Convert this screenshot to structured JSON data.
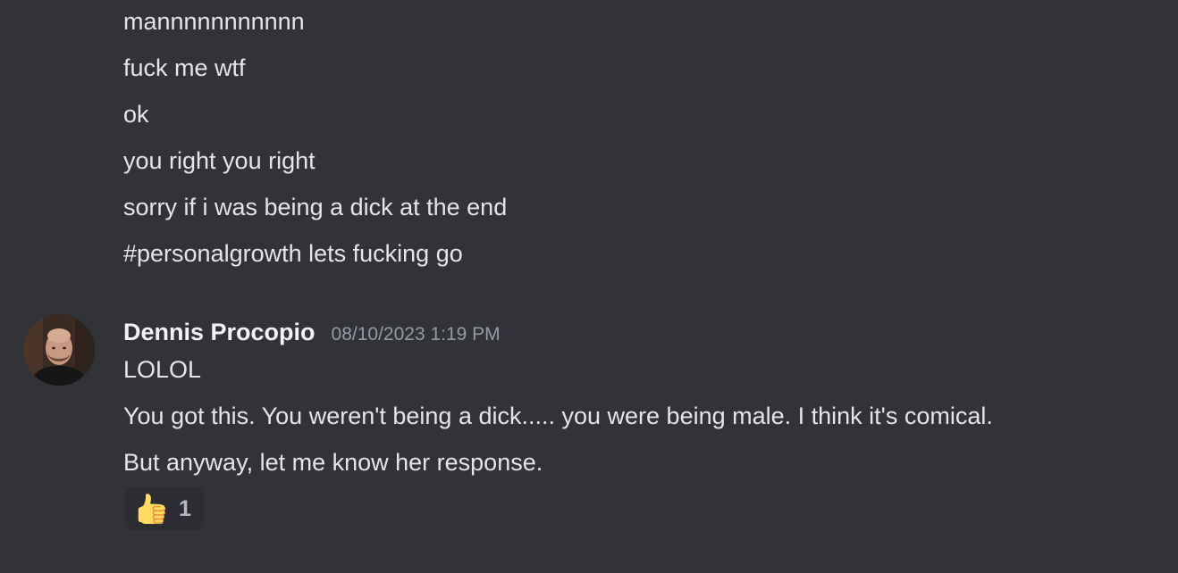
{
  "previous_messages": [
    "mannnnnnnnnnn",
    "fuck me wtf",
    "ok",
    "you right you right",
    "sorry if i was being a dick at the end",
    "#personalgrowth lets fucking go"
  ],
  "message": {
    "author": "Dennis Procopio",
    "timestamp": "08/10/2023 1:19 PM",
    "lines": [
      "LOLOL",
      "You got this. You weren't being a dick..... you were being male. I think it's comical.",
      "But anyway, let me know her response."
    ],
    "avatar_icon": "user-avatar-photo",
    "reaction": {
      "emoji_icon": "thumbs-up-icon",
      "count": "1"
    }
  },
  "colors": {
    "background": "#313338",
    "text": "#e3e5e8",
    "username": "#f2f3f5",
    "timestamp": "#949ba4",
    "reaction_bg": "#2b2d31"
  }
}
